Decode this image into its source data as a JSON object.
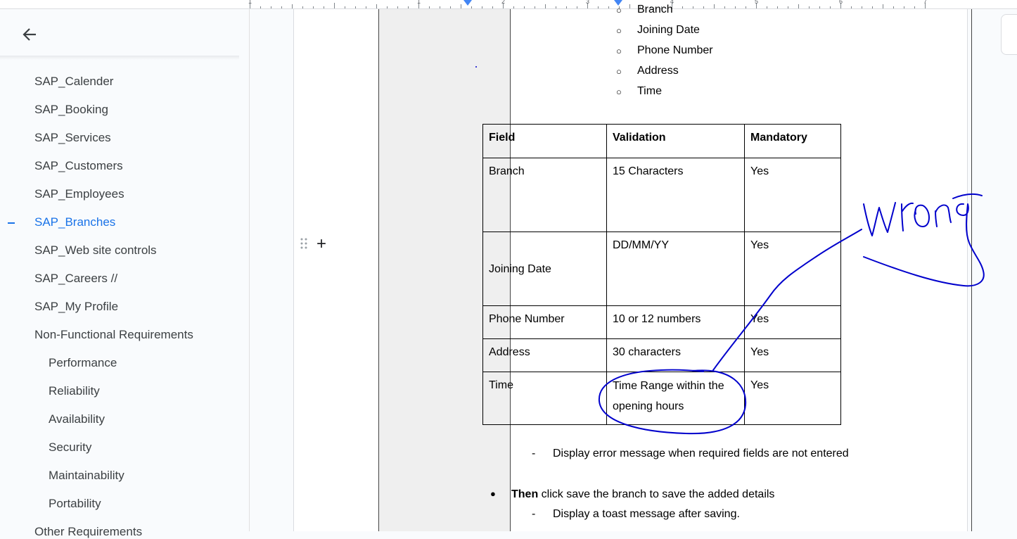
{
  "ruler": {
    "numbers": [
      "1",
      "1",
      "2",
      "3",
      "4",
      "5",
      "6",
      "7"
    ]
  },
  "outline": {
    "items": [
      {
        "label": "SAP_Calender",
        "level": 1
      },
      {
        "label": "SAP_Booking",
        "level": 1
      },
      {
        "label": "SAP_Services",
        "level": 1
      },
      {
        "label": "SAP_Customers",
        "level": 1
      },
      {
        "label": "SAP_Employees",
        "level": 1
      },
      {
        "label": "SAP_Branches",
        "level": 1,
        "active": true
      },
      {
        "label": "SAP_Web site controls",
        "level": 1
      },
      {
        "label": "SAP_Careers //",
        "level": 1
      },
      {
        "label": "SAP_My Profile",
        "level": 1
      },
      {
        "label": "Non-Functional Requirements",
        "level": 1
      },
      {
        "label": "Performance",
        "level": 2
      },
      {
        "label": "Reliability",
        "level": 2
      },
      {
        "label": "Availability",
        "level": 2
      },
      {
        "label": "Security",
        "level": 2
      },
      {
        "label": "Maintainability",
        "level": 2
      },
      {
        "label": "Portability",
        "level": 2
      },
      {
        "label": "Other Requirements",
        "level": 1
      }
    ],
    "accent_color": "#1a73e8"
  },
  "doc": {
    "sub_bullets": [
      "Branch",
      "Joining Date",
      "Phone Number",
      "Address",
      "Time"
    ],
    "table": {
      "headers": [
        "Field",
        "Validation",
        "Mandatory"
      ],
      "rows": [
        [
          "Branch",
          "15 Characters",
          "Yes"
        ],
        [
          "Joining Date",
          "DD/MM/YY",
          "Yes"
        ],
        [
          "Phone Number",
          "10 or 12 numbers",
          "Yes"
        ],
        [
          "Address",
          "30 characters",
          "Yes"
        ],
        [
          "Time",
          "Time Range within the opening hours",
          "Yes"
        ]
      ]
    },
    "dash_item_1": "Display error message when required fields are not entered",
    "bullet_bold": "Then",
    "bullet_rest": " click save the branch to save the added details",
    "dash_item_2": "Display a toast message after saving.",
    "dash_char": "-",
    "bullet_char": "●",
    "circle_char": "○"
  },
  "annotation": {
    "text": "wrong",
    "ink_color": "#0000cc"
  },
  "icons": {
    "back": "arrow-left-icon",
    "drag": "drag-handle-icon",
    "add": "plus-icon"
  }
}
